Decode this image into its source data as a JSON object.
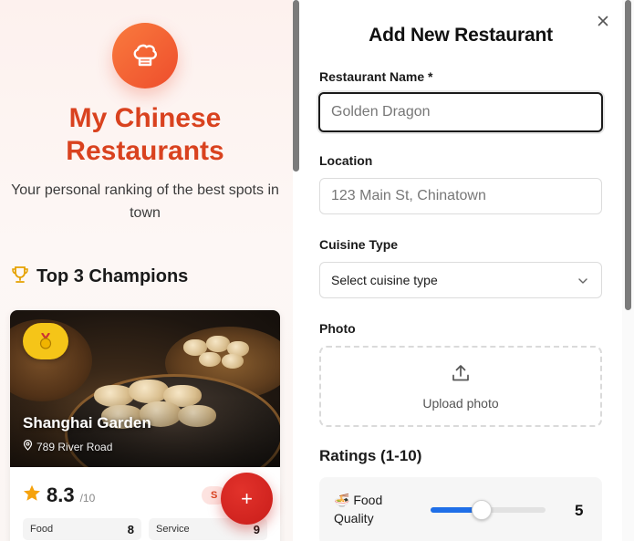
{
  "hero": {
    "title": "My Chinese Restaurants",
    "subtitle": "Your personal ranking of the best spots in town",
    "logo_icon": "chef-hat-icon",
    "accent_color": "#d9421f"
  },
  "champions": {
    "title": "Top 3 Champions",
    "icon": "trophy-icon"
  },
  "card": {
    "badge_icon": "medal-icon",
    "name": "Shanghai Garden",
    "location": "789 River Road",
    "score": "8.3",
    "score_max": "/10",
    "tag": "S",
    "sub_ratings": [
      {
        "label": "Food",
        "value": "8"
      },
      {
        "label": "Service",
        "value": "9"
      }
    ]
  },
  "fab": {
    "label": "+"
  },
  "modal": {
    "title": "Add New Restaurant",
    "close_icon": "close-icon",
    "fields": {
      "name": {
        "label": "Restaurant Name *",
        "placeholder": "Golden Dragon",
        "value": ""
      },
      "location": {
        "label": "Location",
        "placeholder": "123 Main St, Chinatown",
        "value": ""
      },
      "cuisine": {
        "label": "Cuisine Type",
        "selected": "Select cuisine type"
      },
      "photo": {
        "label": "Photo",
        "upload_text": "Upload photo"
      }
    },
    "ratings": {
      "title": "Ratings (1-10)",
      "items": [
        {
          "emoji": "🍜",
          "label": "Food Quality",
          "value": "5",
          "min": 1,
          "max": 10
        }
      ]
    }
  }
}
